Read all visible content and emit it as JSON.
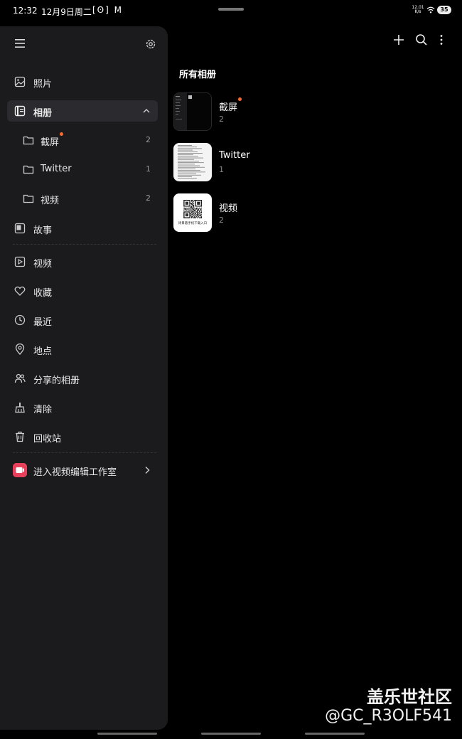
{
  "status_bar": {
    "time": "12:32",
    "date": "12月9日周二",
    "app_icons": "[ʘ] M",
    "net_speed_value": "12.01",
    "net_speed_unit": "K/s",
    "battery": "35"
  },
  "drawer": {
    "items": [
      {
        "label": "照片",
        "icon": "image-icon"
      },
      {
        "label": "相册",
        "icon": "album-icon",
        "expanded": true
      },
      {
        "label": "故事",
        "icon": "story-icon"
      },
      {
        "label": "视频",
        "icon": "video-icon"
      },
      {
        "label": "收藏",
        "icon": "heart-icon"
      },
      {
        "label": "最近",
        "icon": "clock-icon"
      },
      {
        "label": "地点",
        "icon": "location-icon"
      },
      {
        "label": "分享的相册",
        "icon": "people-icon"
      },
      {
        "label": "清除",
        "icon": "broom-icon"
      },
      {
        "label": "回收站",
        "icon": "trash-icon"
      }
    ],
    "sub_albums": [
      {
        "label": "截屏",
        "count": "2",
        "new_dot": true
      },
      {
        "label": "Twitter",
        "count": "1",
        "new_dot": false
      },
      {
        "label": "视频",
        "count": "2",
        "new_dot": false
      }
    ],
    "editor_link": "进入视频编辑工作室"
  },
  "main": {
    "section_title": "所有相册",
    "albums": [
      {
        "name": "截屏",
        "count": "2",
        "new_dot": true
      },
      {
        "name": "Twitter",
        "count": "1",
        "new_dot": false
      },
      {
        "name": "视频",
        "count": "2",
        "new_dot": false
      }
    ],
    "qr_caption": "诗目著手机下载入口"
  },
  "watermark": {
    "line1": "盖乐世社区",
    "line2": "@GC_R3OLF541"
  },
  "colors": {
    "background": "#000000",
    "drawer": "#1b1b1e",
    "active_item": "#2b2b2f",
    "new_dot": "#ff6a2b",
    "editor_icon": "#e8405a"
  }
}
